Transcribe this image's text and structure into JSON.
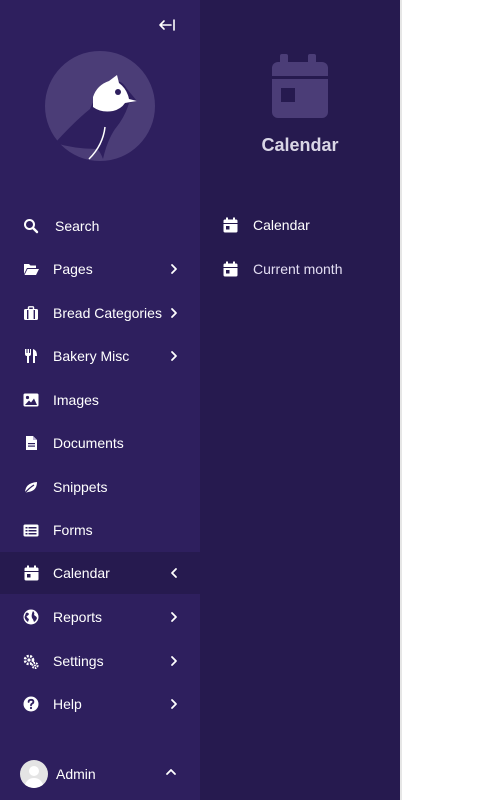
{
  "sidebar": {
    "collapse_icon": "collapse-left-icon",
    "logo": "bird-logo",
    "items": [
      {
        "label": "Search",
        "icon": "search-icon"
      },
      {
        "label": "Pages",
        "icon": "folder-open-icon"
      },
      {
        "label": "Bread Categories",
        "icon": "suitcase-icon"
      },
      {
        "label": "Bakery Misc",
        "icon": "utensils-icon"
      },
      {
        "label": "Images",
        "icon": "image-icon"
      },
      {
        "label": "Documents",
        "icon": "document-icon"
      },
      {
        "label": "Snippets",
        "icon": "leaf-icon"
      },
      {
        "label": "Forms",
        "icon": "list-icon"
      },
      {
        "label": "Calendar",
        "icon": "calendar-icon",
        "active": true
      },
      {
        "label": "Reports",
        "icon": "globe-icon"
      },
      {
        "label": "Settings",
        "icon": "cogs-icon"
      },
      {
        "label": "Help",
        "icon": "help-icon"
      }
    ],
    "account": {
      "label": "Admin",
      "icon": "avatar"
    }
  },
  "submenu": {
    "title": "Calendar",
    "icon": "calendar-icon",
    "items": [
      {
        "label": "Calendar",
        "icon": "calendar-icon"
      },
      {
        "label": "Current month",
        "icon": "calendar-icon"
      }
    ]
  },
  "colors": {
    "sidebar_bg": "#2e1f5e",
    "submenu_bg": "#261a4f",
    "text": "#ffffff"
  }
}
